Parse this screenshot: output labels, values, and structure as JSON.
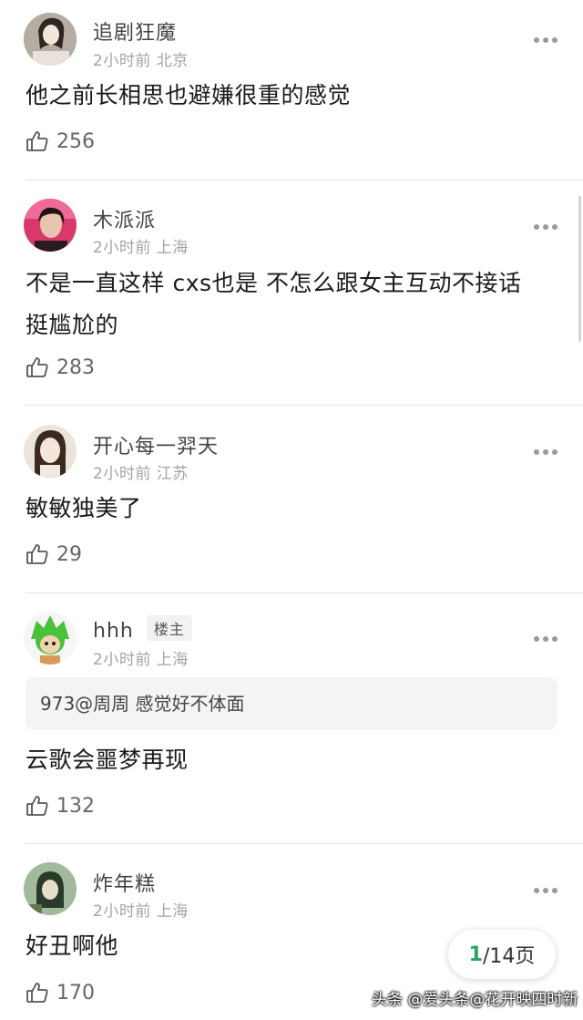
{
  "comments": [
    {
      "username": "追剧狂魔",
      "time": "2小时前",
      "location": "北京",
      "text": "他之前长相思也避嫌很重的感觉",
      "likes": "256",
      "avatar_colors": [
        "#8e8478",
        "#f0ece6",
        "#3a3430"
      ]
    },
    {
      "username": "木派派",
      "time": "2小时前",
      "location": "上海",
      "text": "不是一直这样 cxs也是 不怎么跟女主互动不接话 挺尴尬的",
      "likes": "283",
      "avatar_colors": [
        "#c83a5e",
        "#ef5b8a",
        "#2a1b20"
      ]
    },
    {
      "username": "开心每一羿天",
      "time": "2小时前",
      "location": "江苏",
      "text": "敏敏独美了",
      "likes": "29",
      "avatar_colors": [
        "#e5dad0",
        "#f7efe8",
        "#3b2a22"
      ]
    },
    {
      "username": "hhh",
      "badge": "楼主",
      "time": "2小时前",
      "location": "上海",
      "quote": "973@周周 感觉好不体面",
      "text": "云歌会噩梦再现",
      "likes": "132",
      "avatar_colors": [
        "#f6f6f6",
        "#49c23a",
        "#d99a5a"
      ]
    },
    {
      "username": "炸年糕",
      "time": "2小时前",
      "location": "上海",
      "text": "好丑啊他",
      "likes": "170",
      "avatar_colors": [
        "#6a8a6a",
        "#c8d8c0",
        "#2a3a2a"
      ]
    }
  ],
  "pagination": {
    "current": "1",
    "total_label": "/14页"
  },
  "watermark": "头条 @爱头条@花开映四时新"
}
